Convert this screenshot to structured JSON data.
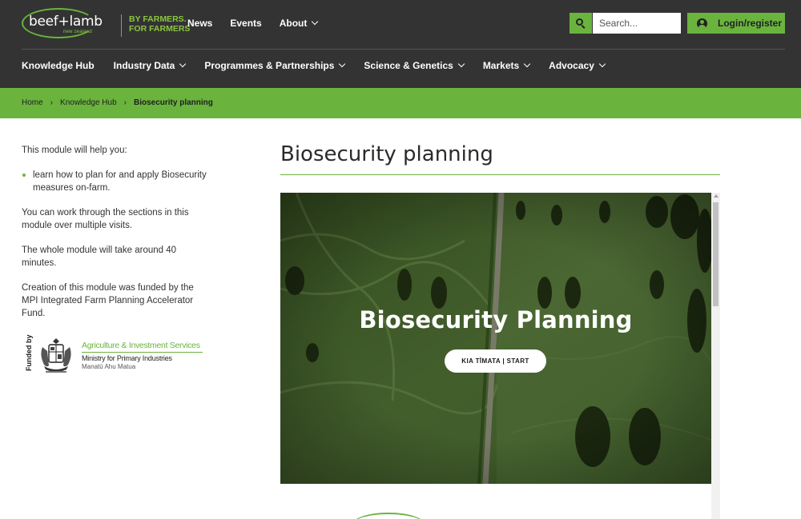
{
  "brand": {
    "logo_word": "beef+lamb",
    "logo_sub": "new zealand",
    "tagline_line1": "BY FARMERS.",
    "tagline_line2": "FOR FARMERS"
  },
  "top_nav": [
    {
      "label": "News",
      "has_dropdown": false
    },
    {
      "label": "Events",
      "has_dropdown": false
    },
    {
      "label": "About",
      "has_dropdown": true
    }
  ],
  "search": {
    "placeholder": "Search...",
    "value": "",
    "icon": "search-icon"
  },
  "login": {
    "label": "Login/register",
    "icon": "user-circle-icon"
  },
  "main_nav": [
    {
      "label": "Knowledge Hub",
      "has_dropdown": false
    },
    {
      "label": "Industry Data",
      "has_dropdown": true
    },
    {
      "label": "Programmes & Partnerships",
      "has_dropdown": true
    },
    {
      "label": "Science & Genetics",
      "has_dropdown": true
    },
    {
      "label": "Markets",
      "has_dropdown": true
    },
    {
      "label": "Advocacy",
      "has_dropdown": true
    }
  ],
  "breadcrumb": {
    "items": [
      "Home",
      "Knowledge Hub"
    ],
    "separator": "›",
    "current": "Biosecurity planning"
  },
  "sidebar": {
    "intro": "This module will help you:",
    "bullets": [
      "learn how to plan for and apply Biosecurity measures on-farm."
    ],
    "p1": "You can work through the sections in this module over multiple visits.",
    "p2": "The whole module will take around 40 minutes.",
    "p3": "Creation of this module was funded by the MPI Integrated Farm Planning Accelerator Fund."
  },
  "funding": {
    "funded_by": "Funded by",
    "org_line1": "Agriculture & Investment Services",
    "org_line2": "Ministry for Primary Industries",
    "org_line3": "Manatū Ahu Matua"
  },
  "page": {
    "title": "Biosecurity planning"
  },
  "module": {
    "hero_title": "Biosecurity Planning",
    "start_label": "KIA TĪMATA | START"
  },
  "colors": {
    "header_bg": "#333333",
    "accent_green": "#6ab43e",
    "text": "#333333"
  }
}
